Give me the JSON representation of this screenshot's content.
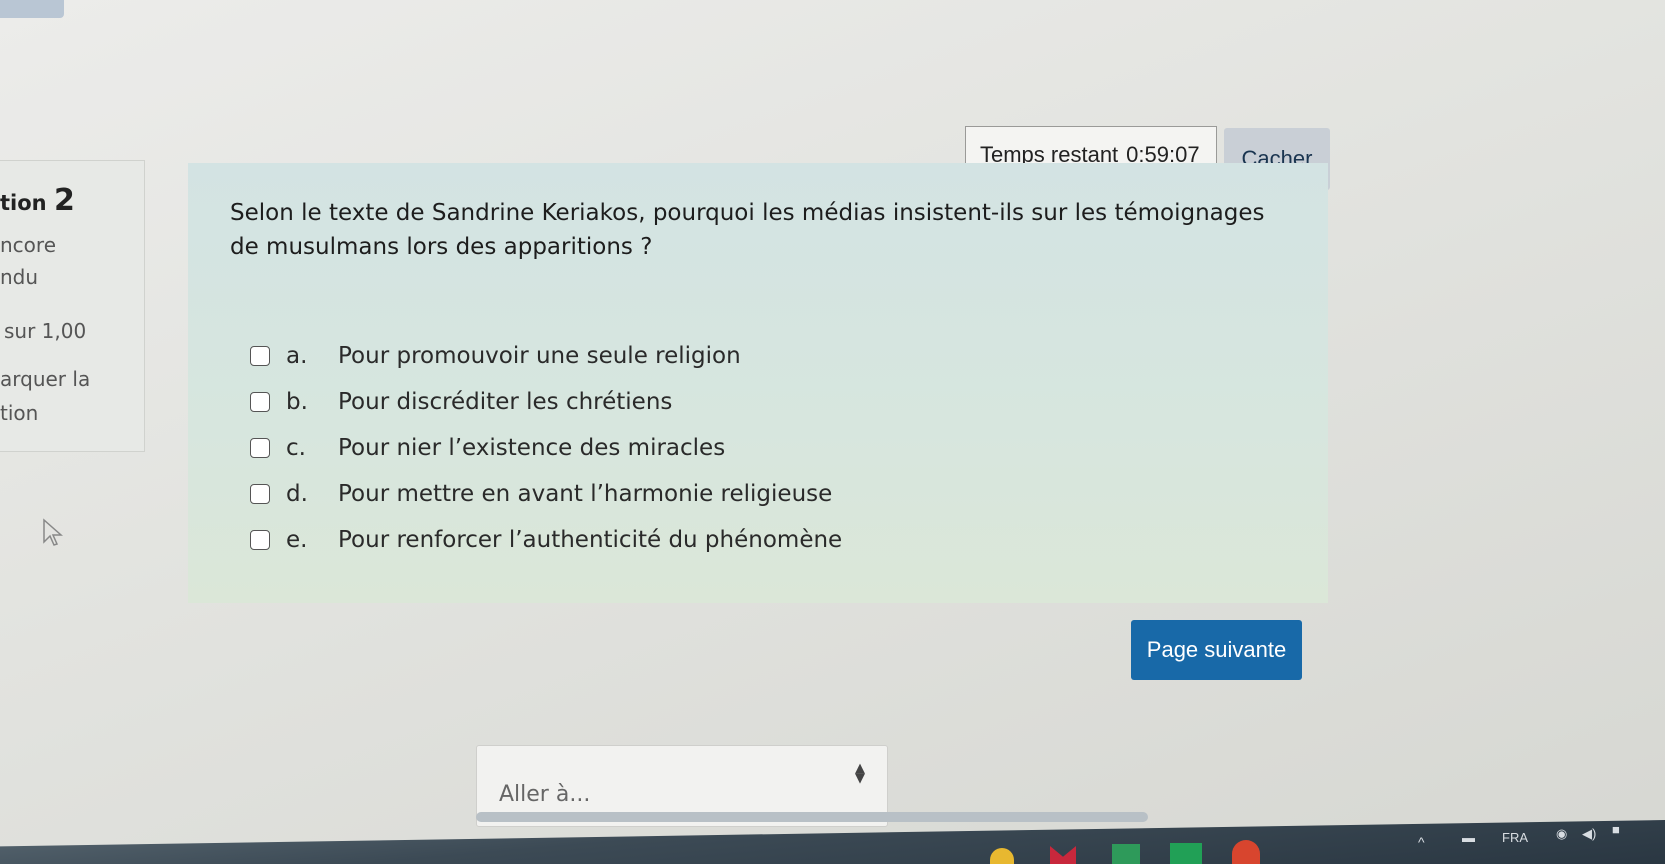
{
  "timer": {
    "label": "Temps restant",
    "value": "0:59:07",
    "hide_label": "Cacher"
  },
  "question_info": {
    "prefix": "tion",
    "number": "2",
    "status_lines": [
      "ncore",
      "ndu"
    ],
    "grade": "sur 1,00",
    "flag_lines": [
      "arquer la",
      "tion"
    ]
  },
  "question": {
    "text": "Selon le texte de Sandrine Keriakos, pourquoi les médias insistent-ils sur les témoignages de musulmans lors des apparitions ?",
    "answers": [
      {
        "letter": "a.",
        "text": "Pour promouvoir une seule religion"
      },
      {
        "letter": "b.",
        "text": "Pour discréditer les chrétiens"
      },
      {
        "letter": "c.",
        "text": "Pour nier l’existence des miracles"
      },
      {
        "letter": "d.",
        "text": "Pour mettre en avant l’harmonie religieuse"
      },
      {
        "letter": "e.",
        "text": "Pour renforcer l’authenticité du phénomène"
      }
    ]
  },
  "navigation": {
    "next_label": "Page suivante",
    "jump_placeholder": "Aller à..."
  },
  "taskbar": {
    "language": "FRA"
  }
}
